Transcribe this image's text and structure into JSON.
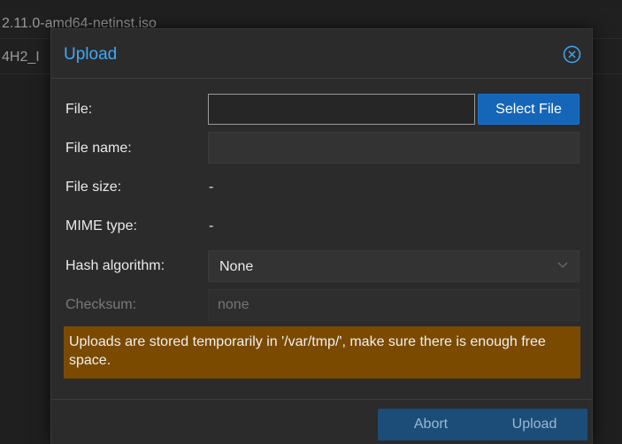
{
  "background": {
    "row1_text": "2.11.0-amd64-netinst.iso",
    "row2_text": "4H2_I"
  },
  "dialog": {
    "title": "Upload",
    "close_icon": "close-circle-icon",
    "fields": {
      "file_label": "File:",
      "file_value": "",
      "select_file_label": "Select File",
      "file_name_label": "File name:",
      "file_name_value": "",
      "file_size_label": "File size:",
      "file_size_value": "-",
      "mime_type_label": "MIME type:",
      "mime_type_value": "-",
      "hash_algorithm_label": "Hash algorithm:",
      "hash_algorithm_value": "None",
      "checksum_label": "Checksum:",
      "checksum_placeholder": "none"
    },
    "warning": "Uploads are stored temporarily in '/var/tmp/', make sure there is enough free space.",
    "buttons": {
      "abort": "Abort",
      "upload": "Upload"
    }
  },
  "colors": {
    "accent": "#3fa9f5",
    "primary_button": "#1565b8",
    "warning_bg": "#7a4a00"
  }
}
